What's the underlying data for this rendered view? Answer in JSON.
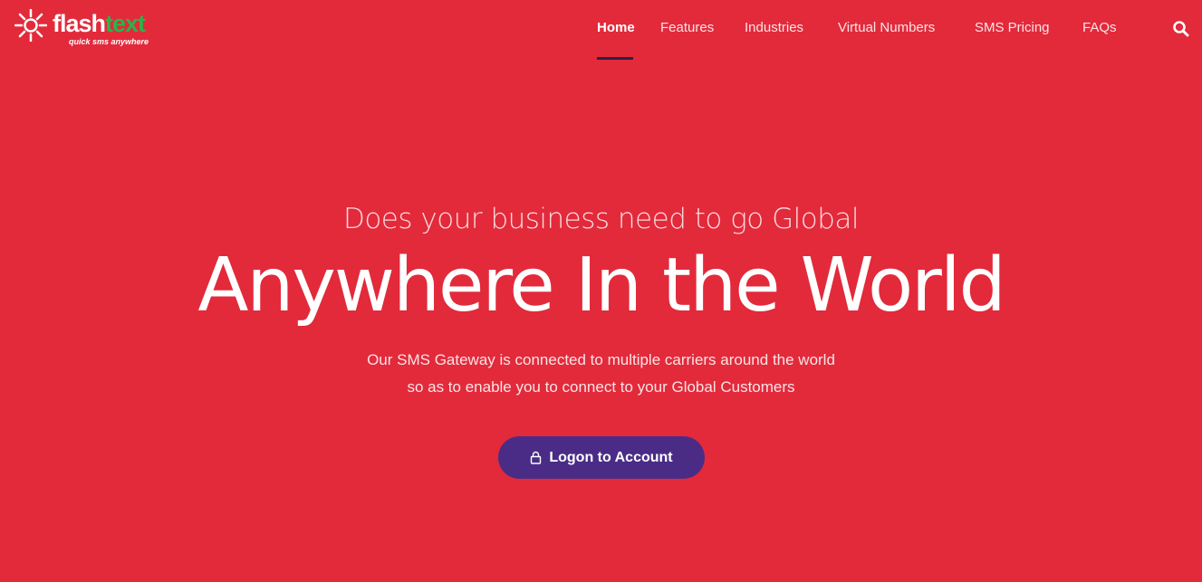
{
  "brand": {
    "name_part1": "flash",
    "name_part2": "text",
    "tagline": "quick sms anywhere",
    "logo_icon": "sun-burst-icon",
    "accent_green": "#2bb34a"
  },
  "nav": {
    "items": [
      {
        "label": "Home",
        "active": true
      },
      {
        "label": "Features",
        "active": false
      },
      {
        "label": "Industries",
        "active": false
      },
      {
        "label": "Virtual Numbers",
        "active": false
      },
      {
        "label": "SMS Pricing",
        "active": false
      },
      {
        "label": "FAQs",
        "active": false
      }
    ],
    "search_icon": "search-icon"
  },
  "hero": {
    "eyebrow": "Does your business need to go Global",
    "title": "Anywhere In the World",
    "description_line1": "Our SMS Gateway is connected to multiple carriers around the world",
    "description_line2": "so as to enable you to connect to your Global Customers",
    "cta_label": "Logon to Account",
    "cta_icon": "lock-icon"
  },
  "colors": {
    "background": "#e22a3b",
    "button": "#4a2c86",
    "nav_underline": "#2b2440"
  }
}
